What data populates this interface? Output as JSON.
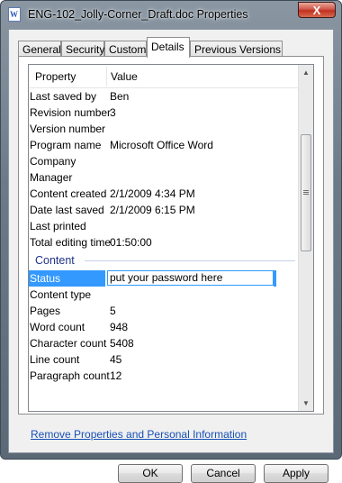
{
  "window": {
    "title": "ENG-102_Jolly-Corner_Draft.doc Properties",
    "close_label": "X",
    "app_icon_label": "W"
  },
  "tabs": [
    {
      "label": "General",
      "active": false
    },
    {
      "label": "Security",
      "active": false
    },
    {
      "label": "Custom",
      "active": false
    },
    {
      "label": "Details",
      "active": true
    },
    {
      "label": "Previous Versions",
      "active": false
    }
  ],
  "columns": {
    "property": "Property",
    "value": "Value"
  },
  "rows": [
    {
      "property": "Last saved by",
      "value": "Ben"
    },
    {
      "property": "Revision number",
      "value": "3"
    },
    {
      "property": "Version number",
      "value": ""
    },
    {
      "property": "Program name",
      "value": "Microsoft Office Word"
    },
    {
      "property": "Company",
      "value": ""
    },
    {
      "property": "Manager",
      "value": ""
    },
    {
      "property": "Content created",
      "value": "2/1/2009 4:34 PM"
    },
    {
      "property": "Date last saved",
      "value": "2/1/2009 6:15 PM"
    },
    {
      "property": "Last printed",
      "value": ""
    },
    {
      "property": "Total editing time",
      "value": "01:50:00"
    }
  ],
  "content_group": {
    "label": "Content",
    "editing_row": {
      "property": "Status",
      "value": "put your password here"
    },
    "rows": [
      {
        "property": "Content type",
        "value": ""
      },
      {
        "property": "Pages",
        "value": "5"
      },
      {
        "property": "Word count",
        "value": "948"
      },
      {
        "property": "Character count",
        "value": "5408"
      },
      {
        "property": "Line count",
        "value": "45"
      },
      {
        "property": "Paragraph count",
        "value": "12"
      }
    ]
  },
  "link_text": "Remove Properties and Personal Information",
  "buttons": {
    "ok": "OK",
    "cancel": "Cancel",
    "apply": "Apply"
  },
  "colors": {
    "selection": "#3399ff",
    "group_text": "#1e3287",
    "link": "#1750b5"
  }
}
